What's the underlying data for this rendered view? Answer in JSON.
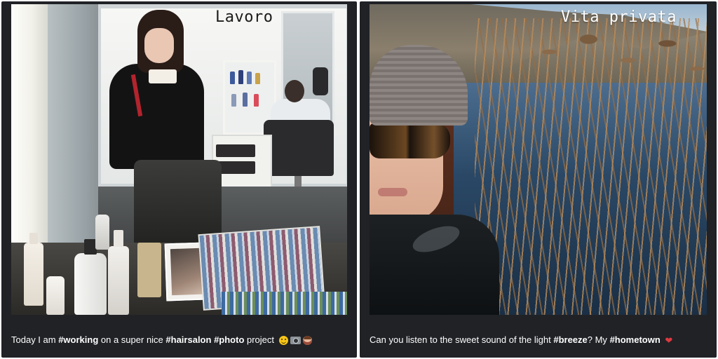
{
  "left_panel": {
    "overlay_title": "Lavoro",
    "caption": {
      "parts": [
        {
          "text": "Today I am ",
          "bold": false
        },
        {
          "text": "#working",
          "bold": true
        },
        {
          "text": " on a super nice ",
          "bold": false
        },
        {
          "text": "#hairsalon",
          "bold": true
        },
        {
          "text": " ",
          "bold": false
        },
        {
          "text": "#photo",
          "bold": true
        },
        {
          "text": " project",
          "bold": false
        }
      ],
      "emojis": [
        "smiling-face-icon",
        "camera-icon",
        "hairdresser-icon"
      ]
    }
  },
  "right_panel": {
    "overlay_title": "Vita privata",
    "caption": {
      "parts": [
        {
          "text": "Can you listen to the sweet sound of the light ",
          "bold": false
        },
        {
          "text": "#breeze",
          "bold": true
        },
        {
          "text": "? My ",
          "bold": false
        },
        {
          "text": "#hometown",
          "bold": true
        }
      ],
      "emojis": [
        "heart-icon"
      ]
    }
  },
  "colors": {
    "card_background": "#202226",
    "caption_text": "#ffffff",
    "heart": "#e0393e"
  }
}
